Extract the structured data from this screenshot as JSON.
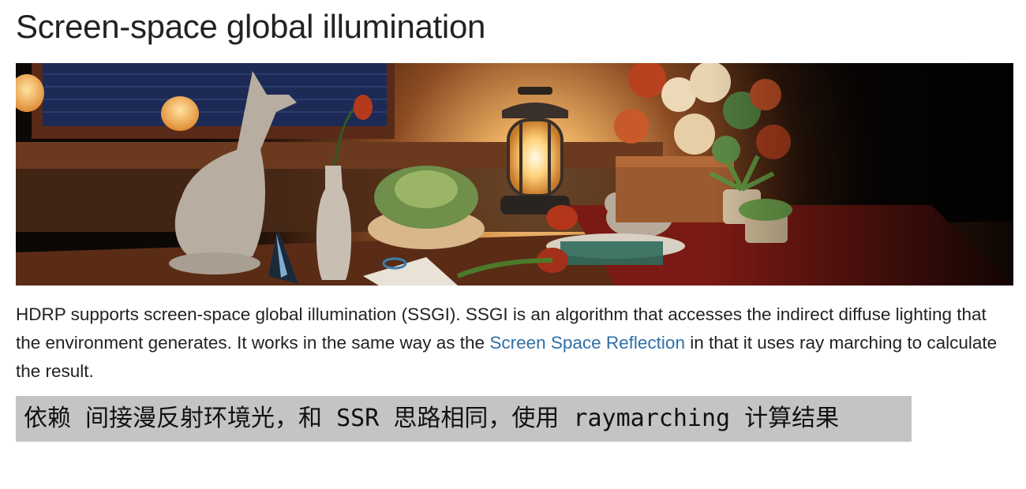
{
  "page": {
    "title": "Screen-space global illumination"
  },
  "paragraph": {
    "part1": "HDRP supports screen-space global illumination (SSGI). SSGI is an algorithm that accesses the indirect diffuse lighting that the environment generates. It works in the same way as the ",
    "link": "Screen Space Reflection",
    "part2": " in that it uses ray marching to calculate the result."
  },
  "note": {
    "text": "依赖 间接漫反射环境光，和 SSR 思路相同，使用 raymarching 计算结果"
  },
  "colors": {
    "link": "#2f6fa8",
    "note_background": "#c4c4c4",
    "title_text": "#222222"
  }
}
